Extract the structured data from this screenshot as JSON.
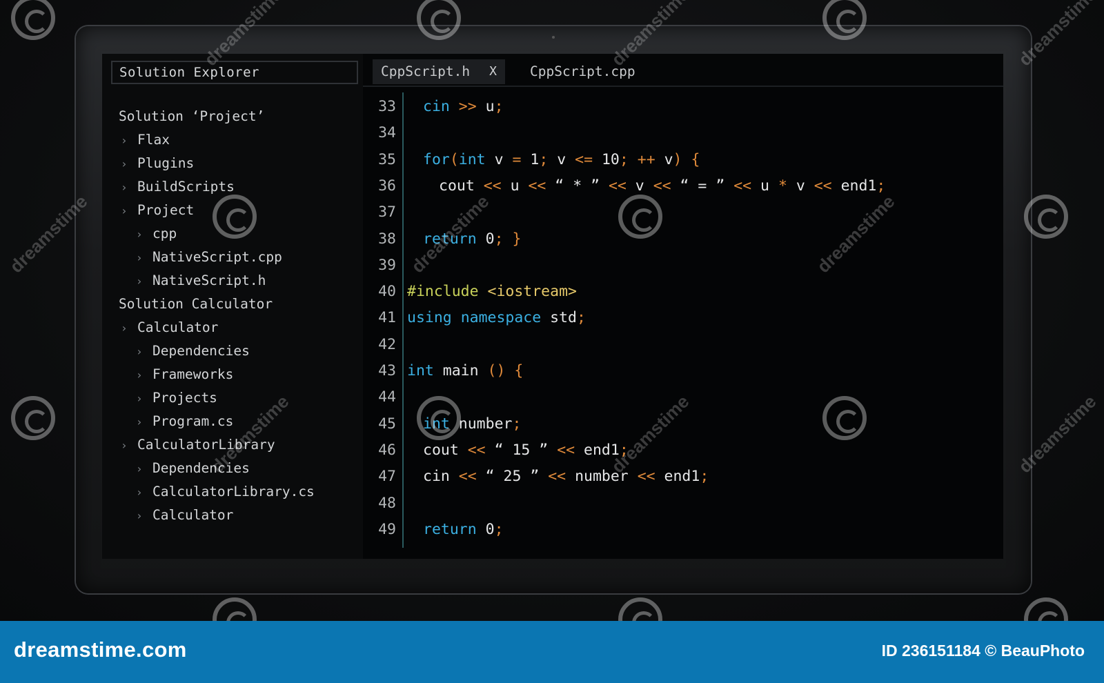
{
  "explorer": {
    "title": "Solution Explorer",
    "items": [
      {
        "label": "Solution ‘Project’",
        "level": 0,
        "chevron": false
      },
      {
        "label": "Flax",
        "level": 1,
        "chevron": true
      },
      {
        "label": "Plugins",
        "level": 1,
        "chevron": true
      },
      {
        "label": "BuildScripts",
        "level": 1,
        "chevron": true
      },
      {
        "label": "Project",
        "level": 1,
        "chevron": true
      },
      {
        "label": "cpp",
        "level": 2,
        "chevron": true
      },
      {
        "label": "NativeScript.cpp",
        "level": 2,
        "chevron": true
      },
      {
        "label": "NativeScript.h",
        "level": 2,
        "chevron": true
      },
      {
        "label": "Solution Calculator",
        "level": 0,
        "chevron": false
      },
      {
        "label": "Calculator",
        "level": 1,
        "chevron": true
      },
      {
        "label": "Dependencies",
        "level": 2,
        "chevron": true
      },
      {
        "label": "Frameworks",
        "level": 2,
        "chevron": true
      },
      {
        "label": "Projects",
        "level": 2,
        "chevron": true
      },
      {
        "label": "Program.cs",
        "level": 2,
        "chevron": true
      },
      {
        "label": "CalculatorLibrary",
        "level": 1,
        "chevron": true
      },
      {
        "label": "Dependencies",
        "level": 2,
        "chevron": true
      },
      {
        "label": "CalculatorLibrary.cs",
        "level": 2,
        "chevron": true
      },
      {
        "label": "Calculator",
        "level": 2,
        "chevron": true
      }
    ]
  },
  "tabs": [
    {
      "label": "CppScript.h",
      "close": "X",
      "active": true
    },
    {
      "label": "CppScript.cpp",
      "active": false
    }
  ],
  "editor": {
    "lines": [
      {
        "n": "33",
        "indent": 1,
        "tokens": [
          [
            "kw",
            "cin"
          ],
          [
            "id",
            " "
          ],
          [
            "op",
            ">>"
          ],
          [
            "id",
            " u"
          ],
          [
            "op",
            ";"
          ]
        ]
      },
      {
        "n": "34",
        "indent": 0,
        "tokens": []
      },
      {
        "n": "35",
        "indent": 1,
        "tokens": [
          [
            "kw",
            "for"
          ],
          [
            "op",
            "("
          ],
          [
            "kw",
            "int"
          ],
          [
            "id",
            " v "
          ],
          [
            "op",
            "="
          ],
          [
            "num",
            " 1"
          ],
          [
            "op",
            ";"
          ],
          [
            "id",
            " v "
          ],
          [
            "op",
            "<="
          ],
          [
            "num",
            " 10"
          ],
          [
            "op",
            ";"
          ],
          [
            "id",
            " "
          ],
          [
            "op",
            "++"
          ],
          [
            "id",
            " v"
          ],
          [
            "op",
            ")"
          ],
          [
            "id",
            " "
          ],
          [
            "op",
            "{"
          ]
        ]
      },
      {
        "n": "36",
        "indent": 2,
        "tokens": [
          [
            "id",
            "cout "
          ],
          [
            "op",
            "<<"
          ],
          [
            "id",
            " u "
          ],
          [
            "op",
            "<<"
          ],
          [
            "str",
            " “ * ” "
          ],
          [
            "op",
            "<<"
          ],
          [
            "id",
            " v "
          ],
          [
            "op",
            "<<"
          ],
          [
            "str",
            " “ = ” "
          ],
          [
            "op",
            "<<"
          ],
          [
            "id",
            " u "
          ],
          [
            "op",
            "*"
          ],
          [
            "id",
            " v "
          ],
          [
            "op",
            "<<"
          ],
          [
            "id",
            " end1"
          ],
          [
            "op",
            ";"
          ]
        ]
      },
      {
        "n": "37",
        "indent": 0,
        "tokens": []
      },
      {
        "n": "38",
        "indent": 1,
        "tokens": [
          [
            "kw",
            "return"
          ],
          [
            "num",
            " 0"
          ],
          [
            "op",
            ";"
          ],
          [
            "id",
            " "
          ],
          [
            "op",
            "}"
          ]
        ]
      },
      {
        "n": "39",
        "indent": 0,
        "tokens": []
      },
      {
        "n": "40",
        "indent": 0,
        "tokens": [
          [
            "pp",
            "#include"
          ],
          [
            "id",
            " "
          ],
          [
            "inc",
            "<iostream>"
          ]
        ]
      },
      {
        "n": "41",
        "indent": 0,
        "tokens": [
          [
            "kw",
            "using"
          ],
          [
            "id",
            " "
          ],
          [
            "kw",
            "namespace"
          ],
          [
            "id",
            " std"
          ],
          [
            "op",
            ";"
          ]
        ]
      },
      {
        "n": "42",
        "indent": 0,
        "tokens": []
      },
      {
        "n": "43",
        "indent": 0,
        "tokens": [
          [
            "kw",
            "int"
          ],
          [
            "id",
            " main "
          ],
          [
            "op",
            "()"
          ],
          [
            "id",
            " "
          ],
          [
            "op",
            "{"
          ]
        ]
      },
      {
        "n": "44",
        "indent": 0,
        "tokens": []
      },
      {
        "n": "45",
        "indent": 1,
        "tokens": [
          [
            "kw",
            "int"
          ],
          [
            "id",
            " number"
          ],
          [
            "op",
            ";"
          ]
        ]
      },
      {
        "n": "46",
        "indent": 1,
        "tokens": [
          [
            "id",
            "cout "
          ],
          [
            "op",
            "<<"
          ],
          [
            "str",
            " “ 15 ” "
          ],
          [
            "op",
            "<<"
          ],
          [
            "id",
            " end1"
          ],
          [
            "op",
            ";"
          ]
        ]
      },
      {
        "n": "47",
        "indent": 1,
        "tokens": [
          [
            "id",
            "cin "
          ],
          [
            "op",
            "<<"
          ],
          [
            "str",
            " “ 25 ” "
          ],
          [
            "op",
            "<<"
          ],
          [
            "id",
            " number "
          ],
          [
            "op",
            "<<"
          ],
          [
            "id",
            " end1"
          ],
          [
            "op",
            ";"
          ]
        ]
      },
      {
        "n": "48",
        "indent": 0,
        "tokens": []
      },
      {
        "n": "49",
        "indent": 1,
        "tokens": [
          [
            "kw",
            "return"
          ],
          [
            "num",
            " 0"
          ],
          [
            "op",
            ";"
          ]
        ]
      }
    ]
  },
  "footer": {
    "brand": "dreamstime.com",
    "credit": "ID 236151184 © BeauPhoto"
  },
  "watermark": {
    "text": "dreamstime"
  },
  "colors": {
    "keyword": "#3bb0e2",
    "operator": "#e08a3a",
    "include": "#e6c96a",
    "footer_bg": "#0b76b2"
  }
}
